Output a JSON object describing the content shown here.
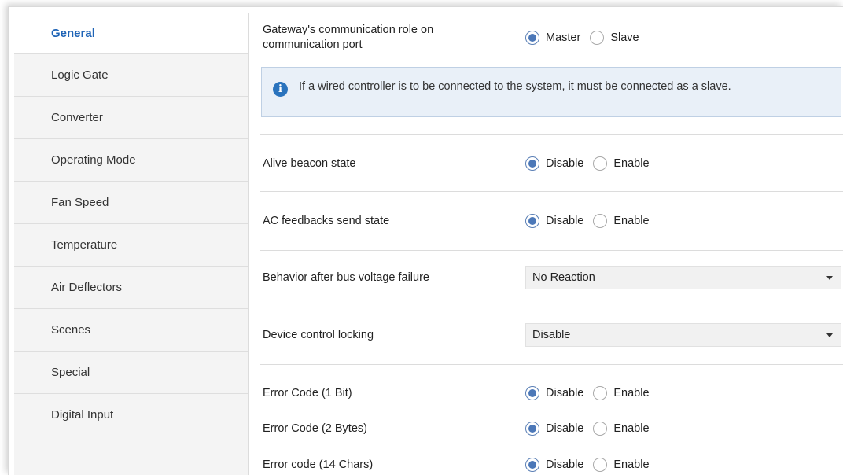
{
  "sidebar": {
    "items": [
      {
        "label": "General"
      },
      {
        "label": "Logic Gate"
      },
      {
        "label": "Converter"
      },
      {
        "label": "Operating Mode"
      },
      {
        "label": "Fan Speed"
      },
      {
        "label": "Temperature"
      },
      {
        "label": "Air Deflectors"
      },
      {
        "label": "Scenes"
      },
      {
        "label": "Special"
      },
      {
        "label": "Digital Input"
      }
    ],
    "active_index": 0
  },
  "main": {
    "comm_role": {
      "label": "Gateway's communication role on communication port",
      "options": [
        "Master",
        "Slave"
      ],
      "selected": "Master"
    },
    "info_note": "If a wired controller is to be connected to the system, it must be connected as a slave.",
    "alive_beacon": {
      "label": "Alive beacon state",
      "options": [
        "Disable",
        "Enable"
      ],
      "selected": "Disable"
    },
    "ac_feedbacks": {
      "label": "AC feedbacks send state",
      "options": [
        "Disable",
        "Enable"
      ],
      "selected": "Disable"
    },
    "bus_voltage": {
      "label": "Behavior after bus voltage failure",
      "value": "No Reaction"
    },
    "control_locking": {
      "label": "Device control locking",
      "value": "Disable"
    },
    "error_1bit": {
      "label": "Error Code (1 Bit)",
      "options": [
        "Disable",
        "Enable"
      ],
      "selected": "Disable"
    },
    "error_2bytes": {
      "label": "Error Code (2 Bytes)",
      "options": [
        "Disable",
        "Enable"
      ],
      "selected": "Disable"
    },
    "error_14chars": {
      "label": "Error code (14 Chars)",
      "options": [
        "Disable",
        "Enable"
      ],
      "selected": "Disable"
    }
  },
  "icons": {
    "info": "info-icon",
    "dropdown": "chevron-down-icon"
  },
  "colors": {
    "accent": "#1f64b6",
    "radio_selected": "#4c78b8",
    "info_bg": "#e9f0f8",
    "info_icon": "#2a73bd"
  }
}
